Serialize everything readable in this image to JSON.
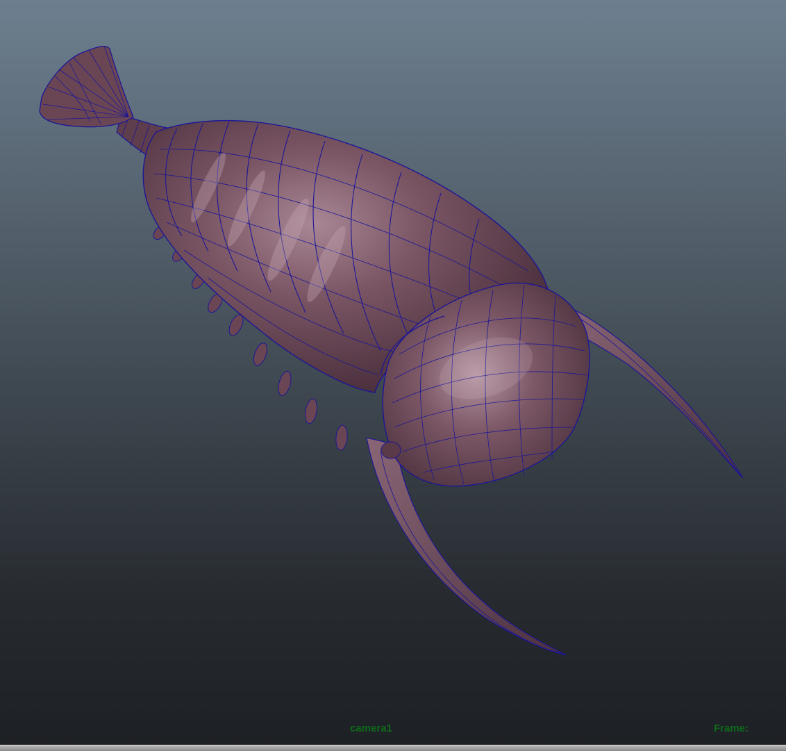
{
  "viewport": {
    "camera_label": "camera1",
    "frame_label": "Frame:",
    "hud_color": "#0e6a1c",
    "background_top": "#6d7f8f",
    "background_bottom": "#1d2024",
    "model_color": "#6e4b59",
    "wireframe_color": "#1c1696"
  }
}
